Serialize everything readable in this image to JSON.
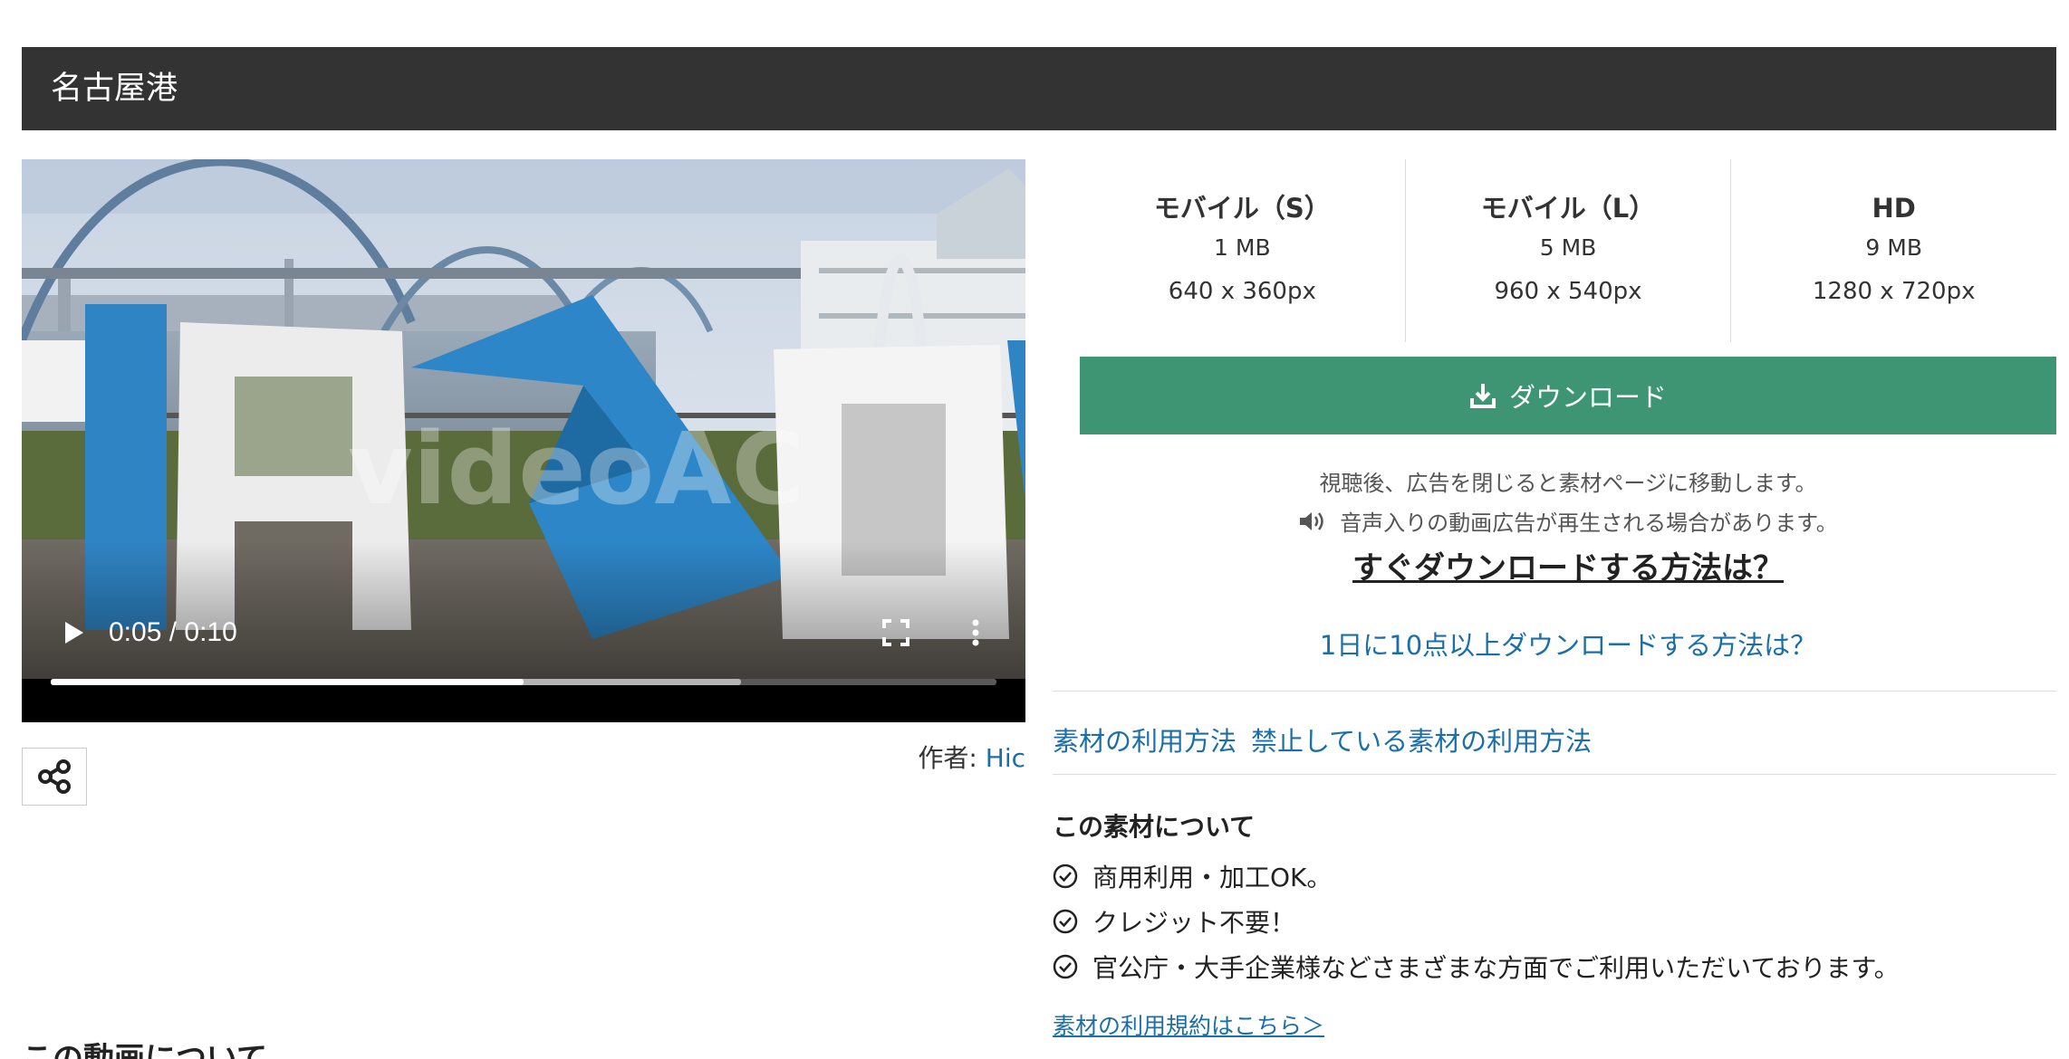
{
  "page_title": "名古屋港",
  "video": {
    "watermark": "videoAC",
    "time_display": "0:05 / 0:10",
    "played_fraction": 0.5,
    "buffered_fraction": 0.73,
    "icons": {
      "play": "play-icon",
      "fullscreen": "fullscreen-icon",
      "more": "more-vert-icon"
    }
  },
  "author": {
    "label": "作者: ",
    "name": "Hic"
  },
  "sizes": [
    {
      "name": "モバイル（S）",
      "mb": "1 MB",
      "px": "640 x 360px"
    },
    {
      "name": "モバイル（L）",
      "mb": "5 MB",
      "px": "960 x 540px"
    },
    {
      "name": "HD",
      "mb": "9 MB",
      "px": "1280 x 720px"
    }
  ],
  "download": {
    "label": "ダウンロード",
    "color": "#3e9574"
  },
  "notes": {
    "line1": "視聴後、広告を閉じると素材ページに移動します。",
    "line2": "音声入りの動画広告が再生される場合があります。"
  },
  "links": {
    "howto": "すぐダウンロードする方法は？",
    "ten_plus": "1日に10点以上ダウンロードする方法は？",
    "usage": "素材の利用方法",
    "prohibited": "禁止している素材の利用方法",
    "terms": "素材の利用規約はこちら＞"
  },
  "about": {
    "heading": "この素材について",
    "features": [
      "商用利用・加工OK。",
      "クレジット不要！",
      "官公庁・大手企業様などさまざまな方面でご利用いただいております。"
    ]
  },
  "about_video_heading": "この動画について",
  "colors": {
    "header_bg": "#333333",
    "link": "#1b6fa8"
  }
}
